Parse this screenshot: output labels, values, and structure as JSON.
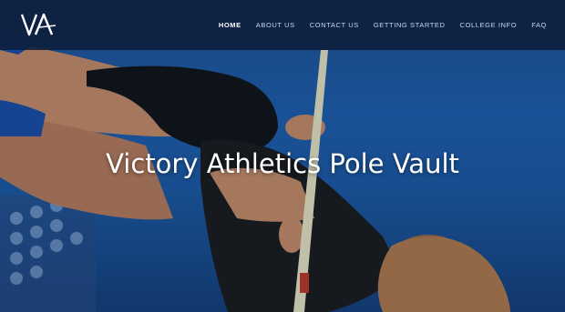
{
  "header": {
    "logo_text": "VA",
    "nav": [
      {
        "label": "HOME"
      },
      {
        "label": "ABOUT US"
      },
      {
        "label": "CONTACT US"
      },
      {
        "label": "GETTING STARTED"
      },
      {
        "label": "COLLEGE INFO"
      },
      {
        "label": "FAQ"
      }
    ]
  },
  "hero": {
    "title": "Victory Athletics Pole Vault",
    "tagline": ""
  },
  "colors": {
    "navbar": "#0c1e3a",
    "nav_text": "#c9d6ea",
    "sky": "#1f5fae",
    "title_text": "#ffffff"
  }
}
